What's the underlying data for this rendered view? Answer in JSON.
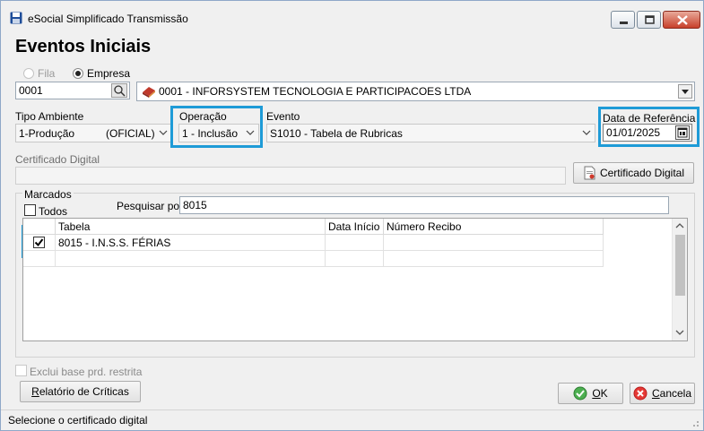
{
  "window": {
    "title": "eSocial Simplificado Transmissão",
    "page_title": "Eventos Iniciais"
  },
  "mode": {
    "fila_label": "Fila",
    "empresa_label": "Empresa",
    "selected": "Empresa"
  },
  "empresa": {
    "code": "0001",
    "name": "0001 - INFORSYSTEM TECNOLOGIA E PARTICIPACOES LTDA"
  },
  "tipo_ambiente": {
    "label": "Tipo Ambiente",
    "value_left": "1-Produção",
    "value_right": "(OFICIAL)"
  },
  "operacao": {
    "label": "Operação",
    "value": "1 - Inclusão"
  },
  "evento": {
    "label": "Evento",
    "value": "S1010 - Tabela de Rubricas"
  },
  "data_referencia": {
    "label": "Data de Referência",
    "value": "01/01/2025"
  },
  "certificado": {
    "label": "Certificado Digital",
    "value": "",
    "button_label": "Certificado Digital"
  },
  "marcados": {
    "group_label": "Marcados",
    "todos_label": "Todos",
    "todos_checked": false,
    "pesquisar_label": "Pesquisar por:",
    "pesquisar_value": "8015"
  },
  "grid": {
    "columns": [
      "Tabela",
      "Data Início",
      "Número Recibo"
    ],
    "rows": [
      {
        "checked": true,
        "tabela": "8015 - I.N.S.S. FÉRIAS",
        "data_inicio": "",
        "numero_recibo": ""
      }
    ]
  },
  "exclui_label": "Exclui base prd. restrita",
  "buttons": {
    "relatorio_prefix": "R",
    "relatorio_rest": "elatório de Críticas",
    "ok_u": "O",
    "ok_rest": "K",
    "cancela_u": "C",
    "cancela_rest": "ancela"
  },
  "status": "Selecione o certificado digital",
  "colors": {
    "highlight": "#1e9bd7",
    "title_icon": "#1f4e9a"
  },
  "icons": [
    "save-icon",
    "minimize-icon",
    "maximize-icon",
    "close-icon",
    "company-icon",
    "lookup-icon",
    "calendar-icon",
    "certificate-icon",
    "ok-icon",
    "cancel-icon",
    "chevron-down-icon",
    "checkmark-icon"
  ]
}
